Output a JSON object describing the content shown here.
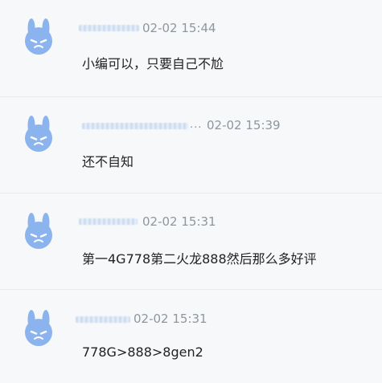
{
  "comments": [
    {
      "time": "02-02 15:44",
      "text": "小编可以，只要自己不尬",
      "name_suffix": ""
    },
    {
      "time": "02-02 15:39",
      "text": "还不自知",
      "name_suffix": "..."
    },
    {
      "time": "02-02 15:31",
      "text": "第一4G778第二火龙888然后那么多好评",
      "name_suffix": ""
    },
    {
      "time": "02-02 15:31",
      "text": "778G>888>8gen2",
      "name_suffix": ""
    }
  ],
  "avatar_icon": "bunny-avatar-icon",
  "colors": {
    "avatar": "#8bb4ee",
    "avatar_face": "#ffffff",
    "text": "#222222",
    "time": "#8e96a0",
    "background": "#f7f8fa"
  }
}
